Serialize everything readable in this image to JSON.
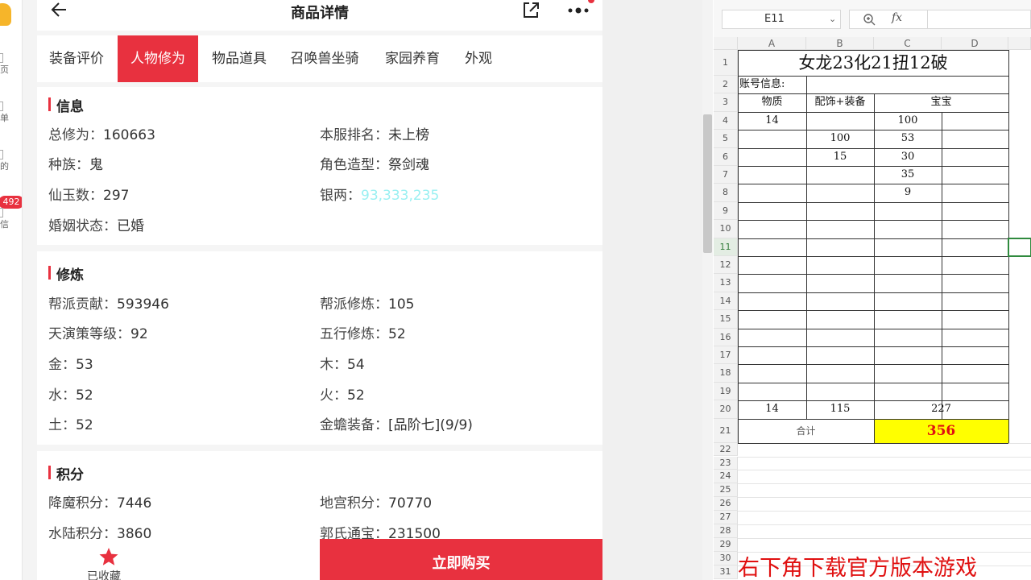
{
  "app": {
    "title": "商品详情",
    "sidebar_badge": "492",
    "sidebar_stubs": [
      "页",
      "单",
      "的",
      "信"
    ],
    "tabs": [
      "装备评价",
      "人物修为",
      "物品道具",
      "召唤兽坐骑",
      "家园养育",
      "外观"
    ],
    "active_tab": 1,
    "sections": {
      "info": {
        "title": "信息",
        "fields": [
          {
            "label": "总修为：",
            "value": "160663"
          },
          {
            "label": "本服排名：",
            "value": "未上榜"
          },
          {
            "label": "种族：",
            "value": "鬼"
          },
          {
            "label": "角色造型：",
            "value": "祭剑魂"
          },
          {
            "label": "仙玉数：",
            "value": "297"
          },
          {
            "label": "银两：",
            "value": "93,333,235"
          },
          {
            "label": "婚姻状态：",
            "value": "已婚"
          }
        ]
      },
      "cultivation": {
        "title": "修炼",
        "fields": [
          {
            "label": "帮派贡献：",
            "value": "593946"
          },
          {
            "label": "帮派修炼：",
            "value": "105"
          },
          {
            "label": "天演策等级：",
            "value": "92"
          },
          {
            "label": "五行修炼：",
            "value": "52"
          },
          {
            "label": "金：",
            "value": "53"
          },
          {
            "label": "木：",
            "value": "54"
          },
          {
            "label": "水：",
            "value": "52"
          },
          {
            "label": "火：",
            "value": "52"
          },
          {
            "label": "土：",
            "value": "52"
          },
          {
            "label": "金蟾装备：",
            "value": "[品阶七](9/9)"
          }
        ]
      },
      "points": {
        "title": "积分",
        "fields": [
          {
            "label": "降魔积分：",
            "value": "7446"
          },
          {
            "label": "地宫积分：",
            "value": "70770"
          },
          {
            "label": "水陆积分：",
            "value": "3860"
          },
          {
            "label": "郭氏通宝：",
            "value": "231500"
          }
        ]
      }
    },
    "bottom": {
      "favorite_label": "已收藏",
      "buy_label": "立即购买"
    },
    "colors": {
      "accent": "#e8313f",
      "silver_value": "#9af0f2"
    }
  },
  "sheet": {
    "name_box": "E11",
    "fx_label": "fx",
    "columns": [
      "A",
      "B",
      "C",
      "D"
    ],
    "rows": [
      "1",
      "2",
      "3",
      "4",
      "5",
      "6",
      "7",
      "8",
      "9",
      "10",
      "11",
      "12",
      "13",
      "14",
      "15",
      "16",
      "17",
      "18",
      "19",
      "20",
      "21",
      "22",
      "23",
      "24",
      "25",
      "26",
      "27",
      "28",
      "29",
      "30",
      "31"
    ],
    "selected_row": "11",
    "title": "女龙23化21扭12破",
    "account_label": "账号信息:",
    "headers": [
      "物质",
      "配饰+装备",
      "宝宝"
    ],
    "data": {
      "A4": "14",
      "C4": "100",
      "B5": "100",
      "C5": "53",
      "B6": "15",
      "C6": "30",
      "C7": "35",
      "C8": "9"
    },
    "totals": {
      "A20": "14",
      "B20": "115",
      "C20": "227"
    },
    "sum_label": "合计",
    "sum_value": "356",
    "overlay_text": "右下角下载官方版本游戏",
    "colors": {
      "highlight": "#ffff00",
      "sum_text": "#e01010",
      "selection": "#2f8a3e"
    }
  }
}
